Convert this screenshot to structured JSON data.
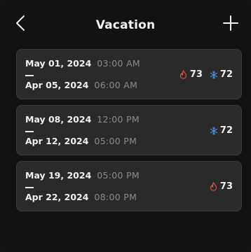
{
  "header": {
    "title": "Vacation"
  },
  "schedules": [
    {
      "start_date": "May 01, 2024",
      "start_time": "03:00 AM",
      "separator": "—",
      "end_date": "Apr 05, 2024",
      "end_time": "06:00 AM",
      "heat": "73",
      "cool": "72"
    },
    {
      "start_date": "May 08, 2024",
      "start_time": "12:00 PM",
      "separator": "—",
      "end_date": "Apr 12, 2024",
      "end_time": "05:00 PM",
      "heat": null,
      "cool": "72"
    },
    {
      "start_date": "May 19, 2024",
      "start_time": "05:00 PM",
      "separator": "—",
      "end_date": "Apr 22, 2024",
      "end_time": "08:00 PM",
      "heat": "73",
      "cool": null
    }
  ],
  "icons": {
    "back": "chevron-left-icon",
    "add": "plus-icon",
    "heat": "flame-icon",
    "cool": "snowflake-icon"
  },
  "colors": {
    "background": "#121212",
    "card": "#2a2a2a",
    "heat": "#e5544b",
    "cool": "#4a90e2",
    "muted_text": "#8a8a8a"
  }
}
